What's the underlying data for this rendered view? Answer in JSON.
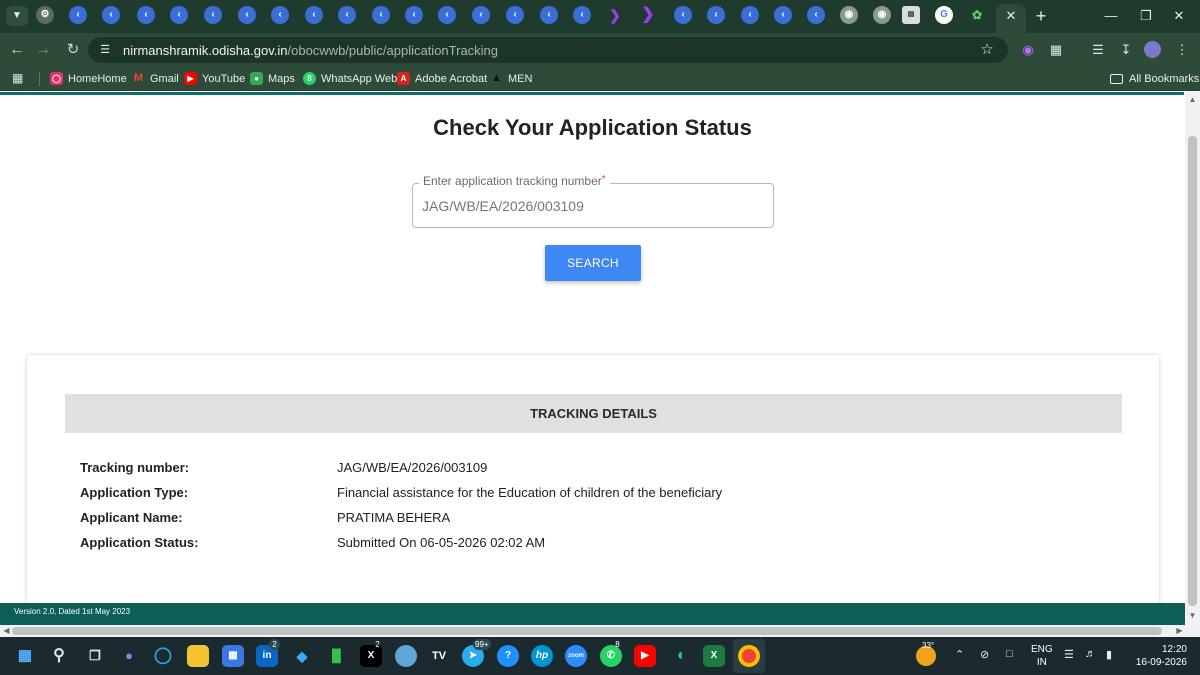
{
  "browser": {
    "tab_strip": {
      "menu_icon": "chevron-down-icon",
      "tab_favicons": [
        "settings-icon",
        "blue-circle",
        "blue-circle",
        "blue-circle",
        "blue-circle",
        "blue-circle",
        "blue-circle",
        "blue-circle",
        "blue-circle",
        "blue-circle",
        "blue-circle",
        "blue-circle",
        "blue-circle",
        "blue-circle",
        "blue-circle",
        "blue-circle",
        "purple-arrow",
        "purple-arrow",
        "blue-circle",
        "blue-circle",
        "blue-circle",
        "blue-circle",
        "globe-icon",
        "globe-icon",
        "news-icon",
        "google-icon",
        "odisha-logo"
      ],
      "close_icon": "close-icon",
      "new_tab_icon": "plus-icon",
      "window_controls": [
        "minimize-icon",
        "restore-icon",
        "close-icon"
      ]
    },
    "toolbar": {
      "url_host": "nirmanshramik.odisha.gov.in",
      "url_path": "/obocwwb/public/applicationTracking"
    },
    "bookmarks": [
      {
        "label": "HomeHome",
        "icon": "instagram-icon",
        "color": "#e1306c"
      },
      {
        "label": "Gmail",
        "icon": "gmail-icon",
        "color": "#ea4335"
      },
      {
        "label": "YouTube",
        "icon": "youtube-icon",
        "color": "#ff0000"
      },
      {
        "label": "Maps",
        "icon": "maps-icon",
        "color": "#34a853"
      },
      {
        "label": "WhatsApp Web",
        "icon": "whatsapp-icon",
        "color": "#25d366"
      },
      {
        "label": "Adobe Acrobat",
        "icon": "acrobat-icon",
        "color": "#d9231e"
      },
      {
        "label": "MEN",
        "icon": "men-icon",
        "color": "#111111"
      }
    ],
    "all_bookmarks_label": "All Bookmarks"
  },
  "page": {
    "title": "Check Your Application Status",
    "search": {
      "label": "Enter application tracking number",
      "required_mark": "*",
      "value": "JAG/WB/EA/2026/003109",
      "button_label": "SEARCH"
    },
    "tracking": {
      "heading": "TRACKING DETAILS",
      "rows": [
        {
          "label": "Tracking number:",
          "value": "JAG/WB/EA/2026/003109"
        },
        {
          "label": "Application Type:",
          "value": "Financial assistance for the Education of children of the beneficiary"
        },
        {
          "label": "Applicant Name:",
          "value": "PRATIMA BEHERA"
        },
        {
          "label": "Application Status:",
          "value": "Submitted On 06-05-2026 02:02 AM"
        }
      ]
    },
    "footer": {
      "version_text": "Version 2.0, Dated 1st May 2023"
    }
  },
  "taskbar": {
    "badges": {
      "linkedin": "2",
      "x": "2",
      "telegram": "99+",
      "whatsapp": "8"
    },
    "weather_temp": "33°",
    "language": {
      "line1": "ENG",
      "line2": "IN"
    },
    "clock": {
      "time": "12:20",
      "date": "16-09-2026"
    },
    "colors": {
      "accent": "#3f88f3",
      "footer": "#0b5f57",
      "teal_line": "#0e6f6a"
    }
  }
}
